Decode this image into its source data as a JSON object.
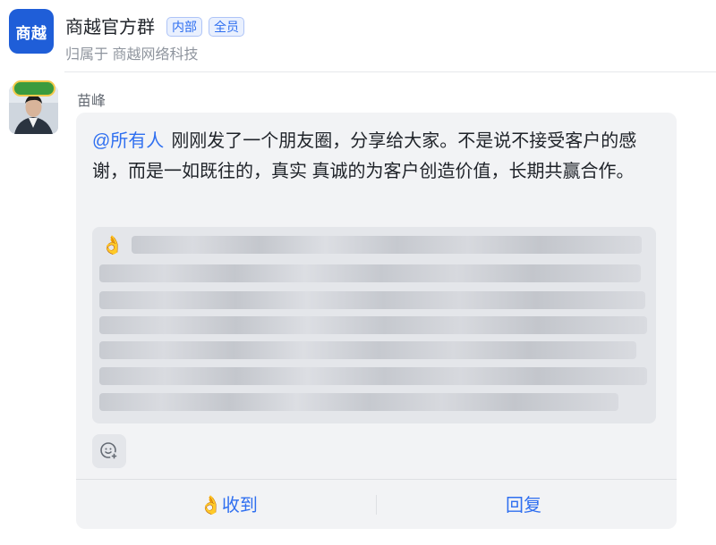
{
  "group": {
    "avatar_text": "商越",
    "title": "商越官方群",
    "tags": [
      "内部",
      "全员"
    ],
    "owner_text": "归属于 商越网络科技"
  },
  "message": {
    "sender": "苗峰",
    "mention": "@所有人",
    "text": "刚刚发了一个朋友圈，分享给大家。不是说不接受客户的感谢，而是一如既往的，真实 真诚的为客户创造价值，长期共赢合作。",
    "quote_emoji": "👌"
  },
  "actions": {
    "received_emoji": "👌",
    "received_label": "收到",
    "reply_label": "回复"
  },
  "colors": {
    "accent": "#2f6ff0",
    "group_avatar_bg": "#1f5ed8",
    "card_bg": "#f2f3f5"
  }
}
